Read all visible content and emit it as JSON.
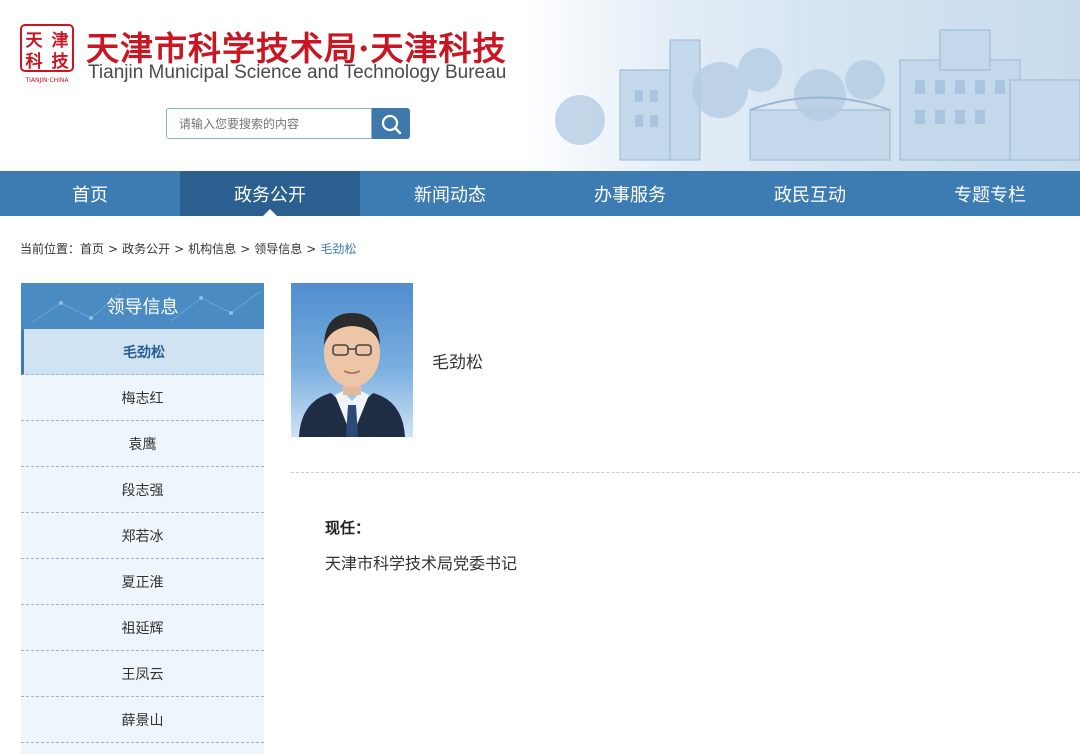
{
  "header": {
    "seal_chars": [
      "天",
      "津",
      "科",
      "技"
    ],
    "seal_caption": "TIANJIN·CHINA",
    "title_cn": "天津市科学技术局·天津科技",
    "title_en": "Tianjin Municipal Science and Technology Bureau",
    "search": {
      "placeholder": "请输入您要搜索的内容",
      "icon": "search-icon"
    }
  },
  "nav": {
    "items": [
      {
        "label": "首页",
        "active": false
      },
      {
        "label": "政务公开",
        "active": true
      },
      {
        "label": "新闻动态",
        "active": false
      },
      {
        "label": "办事服务",
        "active": false
      },
      {
        "label": "政民互动",
        "active": false
      },
      {
        "label": "专题专栏",
        "active": false
      }
    ]
  },
  "breadcrumb": {
    "prefix": "当前位置：",
    "items": [
      "首页",
      "政务公开",
      "机构信息",
      "领导信息"
    ],
    "current": "毛劲松",
    "separator": ">"
  },
  "sidebar": {
    "title": "领导信息",
    "items": [
      {
        "label": "毛劲松",
        "active": true
      },
      {
        "label": "梅志红",
        "active": false
      },
      {
        "label": "袁鹰",
        "active": false
      },
      {
        "label": "段志强",
        "active": false
      },
      {
        "label": "郑若冰",
        "active": false
      },
      {
        "label": "夏正淮",
        "active": false
      },
      {
        "label": "祖延辉",
        "active": false
      },
      {
        "label": "王凤云",
        "active": false
      },
      {
        "label": "薛景山",
        "active": false
      }
    ]
  },
  "profile": {
    "name": "毛劲松",
    "position_label": "现任：",
    "position_value": "天津市科学技术局党委书记"
  },
  "colors": {
    "nav": "#3d7bb3",
    "nav_active": "#2a5f8f",
    "logo_red": "#c81623",
    "sidebar_bg": "#eef5fb",
    "sidebar_title": "#4b8bc4"
  }
}
